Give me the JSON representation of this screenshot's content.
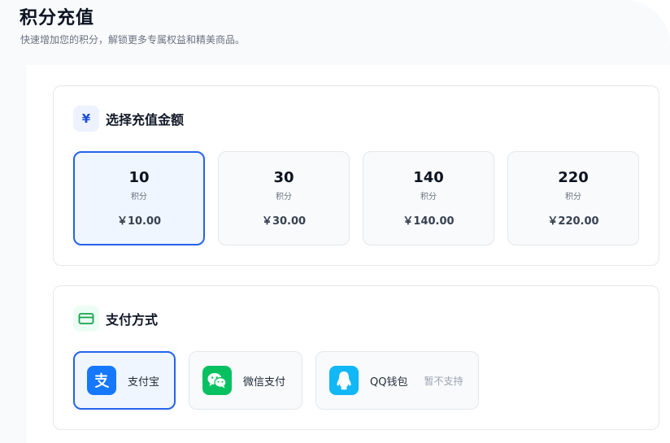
{
  "page": {
    "title": "积分充值",
    "subtitle": "快速增加您的积分，解锁更多专属权益和精美商品。"
  },
  "amount_section": {
    "icon": "yuan-icon",
    "icon_glyph": "¥",
    "title": "选择充值金额",
    "options": [
      {
        "points": "10",
        "unit": "积分",
        "price": "￥10.00",
        "selected": true
      },
      {
        "points": "30",
        "unit": "积分",
        "price": "￥30.00",
        "selected": false
      },
      {
        "points": "140",
        "unit": "积分",
        "price": "￥140.00",
        "selected": false
      },
      {
        "points": "220",
        "unit": "积分",
        "price": "￥220.00",
        "selected": false
      }
    ]
  },
  "payment_section": {
    "icon": "credit-card-icon",
    "title": "支付方式",
    "methods": [
      {
        "id": "alipay",
        "icon": "alipay-icon",
        "label": "支付宝",
        "note": "",
        "selected": true
      },
      {
        "id": "wechat",
        "icon": "wechat-icon",
        "label": "微信支付",
        "note": "",
        "selected": false
      },
      {
        "id": "qq",
        "icon": "qq-icon",
        "label": "QQ钱包",
        "note": "暂不支持",
        "selected": false
      }
    ]
  },
  "colors": {
    "accent": "#2563eb",
    "alipay": "#1677ff",
    "wechat": "#07c160",
    "qq": "#12b7f5"
  }
}
